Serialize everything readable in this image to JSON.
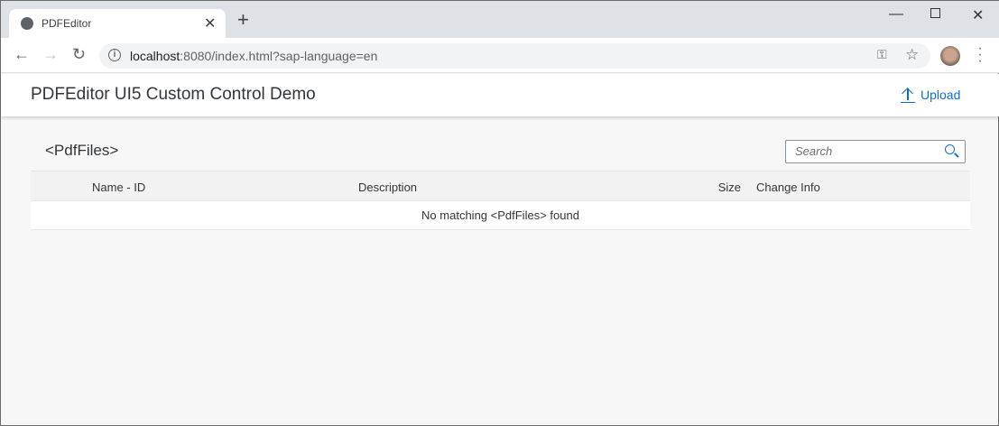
{
  "browser": {
    "tab_title": "PDFEditor",
    "url_host": "localhost",
    "url_rest": ":8080/index.html?sap-language=en"
  },
  "app": {
    "title": "PDFEditor UI5 Custom Control Demo",
    "upload_label": "Upload"
  },
  "list": {
    "title": "<PdfFiles>",
    "search_placeholder": "Search",
    "columns": [
      "Name - ID",
      "Description",
      "Size",
      "Change Info"
    ],
    "no_data": "No matching <PdfFiles> found"
  },
  "colors": {
    "accent": "#0a6ed1",
    "text": "#32363a",
    "background": "#f7f7f7"
  }
}
